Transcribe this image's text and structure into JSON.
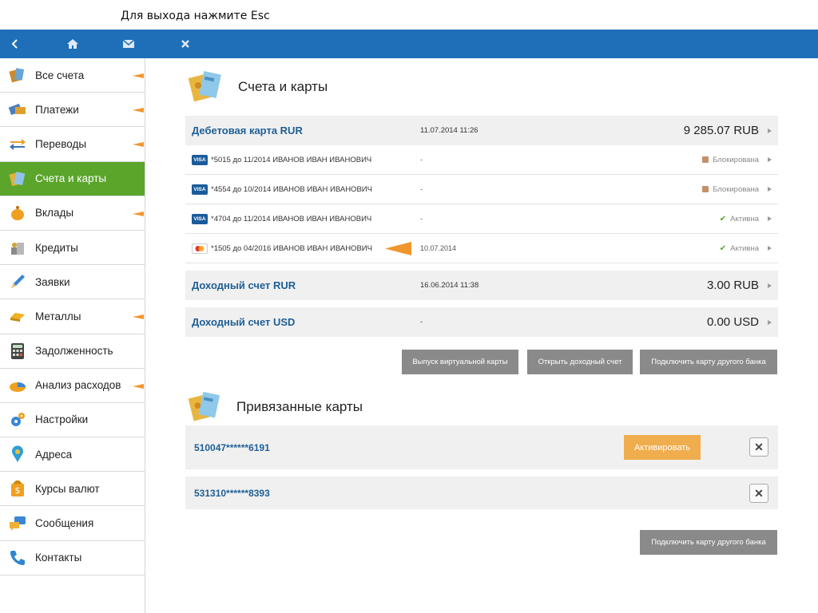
{
  "hint": "Для выхода нажмите Esc",
  "topbar": {
    "color": "#1f6fb8",
    "icons": [
      "back-icon",
      "home-icon",
      "mail-icon",
      "close-icon"
    ]
  },
  "sidebar": {
    "active_color": "#5aa52a",
    "items": [
      {
        "label": "Все счета",
        "icon": "accounts-icon"
      },
      {
        "label": "Платежи",
        "icon": "payments-icon"
      },
      {
        "label": "Переводы",
        "icon": "transfers-icon"
      },
      {
        "label": "Счета и карты",
        "icon": "cards-icon"
      },
      {
        "label": "Вклады",
        "icon": "deposits-icon"
      },
      {
        "label": "Кредиты",
        "icon": "credits-icon"
      },
      {
        "label": "Заявки",
        "icon": "requests-icon"
      },
      {
        "label": "Металлы",
        "icon": "metals-icon"
      },
      {
        "label": "Задолженность",
        "icon": "debt-icon"
      },
      {
        "label": "Анализ расходов",
        "icon": "expenses-icon"
      },
      {
        "label": "Настройки",
        "icon": "settings-icon"
      },
      {
        "label": "Адреса",
        "icon": "location-icon"
      },
      {
        "label": "Курсы валют",
        "icon": "currency-icon"
      },
      {
        "label": "Сообщения",
        "icon": "messages-icon"
      },
      {
        "label": "Контакты",
        "icon": "phone-icon"
      }
    ]
  },
  "accounts_section": {
    "title": "Счета и карты",
    "debit": {
      "name": "Дебетовая карта RUR",
      "date": "11.07.2014 11:26",
      "amount": "9 285.07 RUB"
    },
    "cards": [
      {
        "brand": "VISA",
        "text": "*5015 до 11/2014 ИВАНОВ ИВАН ИВАНОВИЧ",
        "date": "-",
        "status": "Блокирована",
        "state": "blocked"
      },
      {
        "brand": "VISA",
        "text": "*4554 до 10/2014 ИВАНОВ ИВАН ИВАНОВИЧ",
        "date": "-",
        "status": "Блокирована",
        "state": "blocked"
      },
      {
        "brand": "VISA",
        "text": "*4704 до 11/2014 ИВАНОВ ИВАН ИВАНОВИЧ",
        "date": "-",
        "status": "Активна",
        "state": "active"
      },
      {
        "brand": "MC",
        "text": "*1505 до 04/2016 ИВАНОВ ИВАН ИВАНОВИЧ",
        "date": "10.07.2014",
        "status": "Активна",
        "state": "active"
      }
    ],
    "income_rur": {
      "name": "Доходный счет RUR",
      "date": "16.06.2014 11:38",
      "amount": "3.00 RUB"
    },
    "income_usd": {
      "name": "Доходный счет USD",
      "date": "-",
      "amount": "0.00 USD"
    },
    "buttons": {
      "virtual_card": "Выпуск виртуальной карты",
      "open_income": "Открыть доходный счет",
      "connect_other": "Подключить карту другого банка"
    }
  },
  "linked_section": {
    "title": "Привязанные карты",
    "cards": [
      {
        "number": "510047******6191",
        "activate_label": "Активировать"
      },
      {
        "number": "531310******8393"
      }
    ],
    "remove_label": "✕",
    "connect_other": "Подключить карту другого банка"
  }
}
